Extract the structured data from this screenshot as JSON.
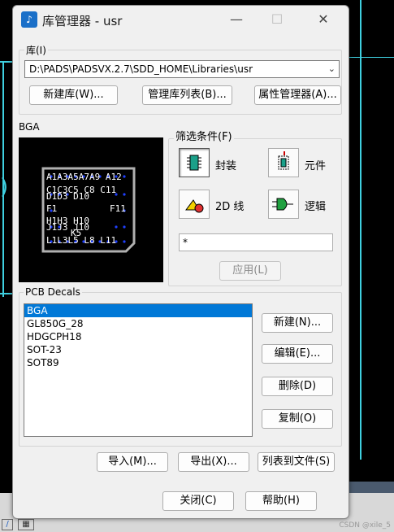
{
  "window": {
    "title": "库管理器 - usr",
    "app_icon_glyph": "♪",
    "minimize_glyph": "—",
    "maximize_glyph": "☐",
    "close_glyph": "✕"
  },
  "library": {
    "group_label": "库(I)",
    "path": "D:\\PADS\\PADSVX.2.7\\SDD_HOME\\Libraries\\usr",
    "new_library_label": "新建库(W)...",
    "manage_list_label": "管理库列表(B)...",
    "attribute_manager_label": "属性管理器(A)..."
  },
  "preview": {
    "label": "BGA",
    "pin_labels": [
      "A1A3A5A7A9 A12",
      "C1C3C5  C8 C11",
      "D1D3       D10",
      "F1",
      "F11",
      "H1H3       H10",
      "J1J3        J10",
      "K5",
      "L1L3L5 L8 L11"
    ]
  },
  "filter": {
    "group_label": "筛选条件(F)",
    "decals_label": "封装",
    "parts_label": "元件",
    "lines_label": "2D 线",
    "logic_label": "逻辑",
    "filter_value": "*",
    "apply_label": "应用(L)"
  },
  "decals": {
    "group_label": "PCB Decals",
    "items": [
      "BGA",
      "GL850G_28",
      "HDGCPH18",
      "SOT-23",
      "SOT89"
    ],
    "selected": "BGA",
    "new_label": "新建(N)...",
    "edit_label": "编辑(E)...",
    "delete_label": "删除(D)",
    "copy_label": "复制(O)"
  },
  "actions": {
    "import_label": "导入(M)...",
    "export_label": "导出(X)...",
    "list_to_file_label": "列表到文件(S)",
    "close_label": "关闭(C)",
    "help_label": "帮助(H)"
  },
  "watermark": "CSDN @xile_5",
  "colors": {
    "accent": "#0078d7",
    "canvas": "#000000",
    "trace": "#3fd0e0"
  }
}
